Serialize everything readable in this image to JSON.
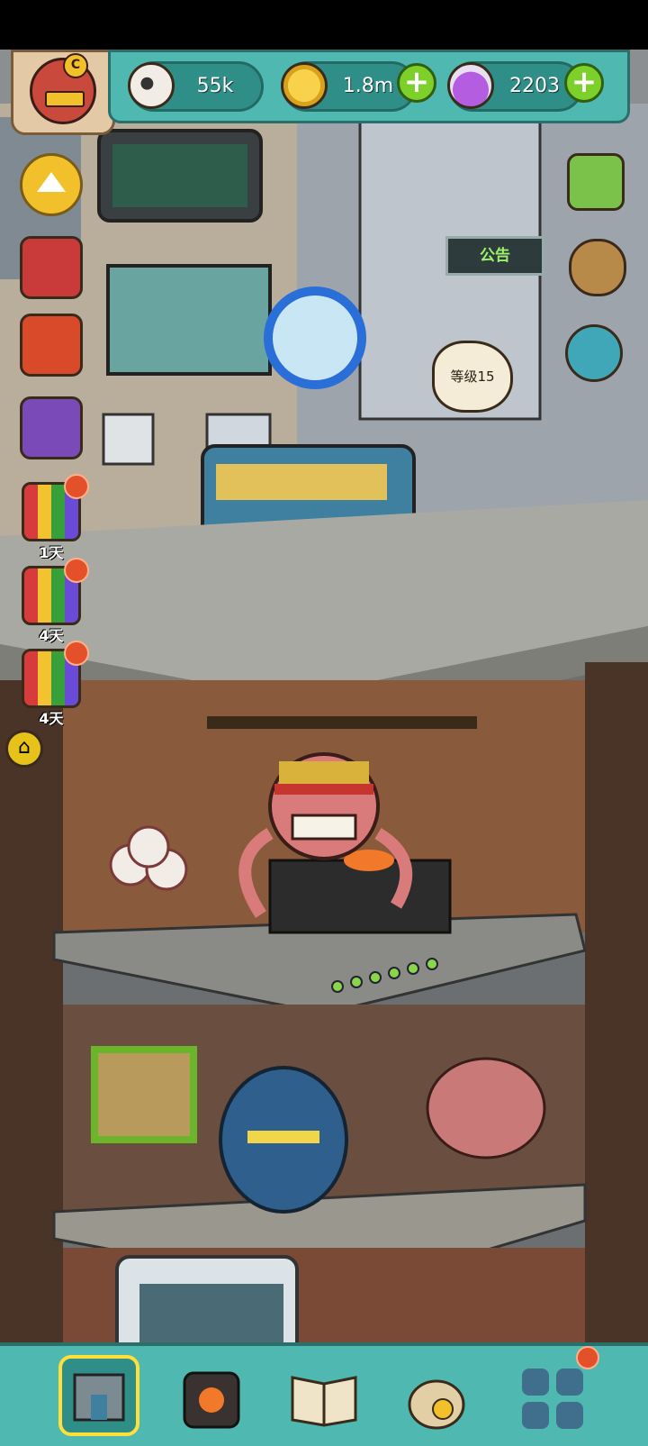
{
  "resources": {
    "eyeballs": {
      "value": "55k",
      "icon": "eyeball-icon"
    },
    "coins": {
      "value": "1.8m",
      "icon": "coin-icon"
    },
    "potions": {
      "value": "2203",
      "icon": "potion-icon"
    }
  },
  "level_bubble": "等级15",
  "notice_sign": "公告",
  "gifts": [
    {
      "label": "1天"
    },
    {
      "label": "4天"
    },
    {
      "label": "4天"
    }
  ],
  "avatar_badge": "C",
  "colors": {
    "accent": "#4fb8b0",
    "plus": "#7dcf2a",
    "badge": "#e4502a"
  }
}
